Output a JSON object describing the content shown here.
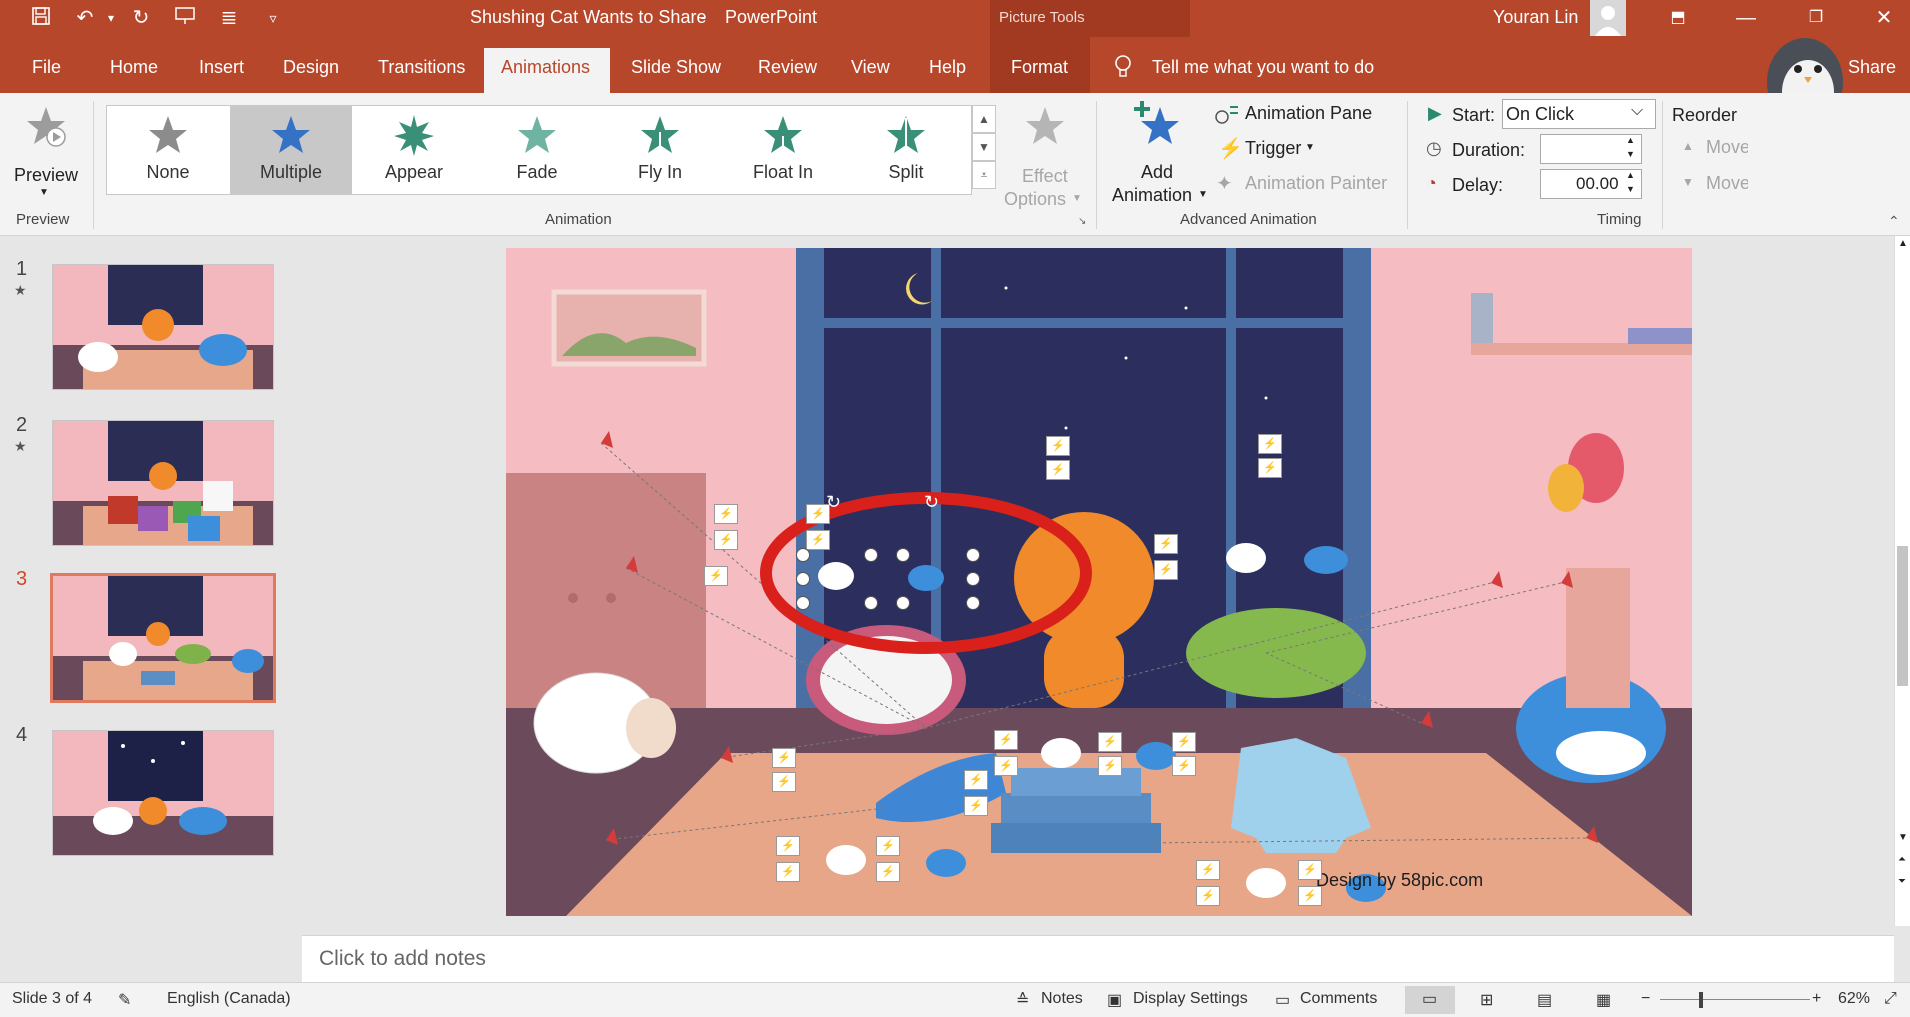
{
  "titlebar": {
    "doc_title": "Shushing Cat Wants to Share",
    "separator": "-",
    "app_name": "PowerPoint",
    "contextual_tools": "Picture Tools",
    "user_name": "Youran Lin",
    "quick_access": [
      "save-icon",
      "undo-icon",
      "undo-dropdown-icon",
      "redo-icon",
      "present-icon",
      "touch-mode-icon",
      "customize-icon"
    ]
  },
  "tabs": [
    {
      "label": "File"
    },
    {
      "label": "Home"
    },
    {
      "label": "Insert"
    },
    {
      "label": "Design"
    },
    {
      "label": "Transitions"
    },
    {
      "label": "Animations"
    },
    {
      "label": "Slide Show"
    },
    {
      "label": "Review"
    },
    {
      "label": "View"
    },
    {
      "label": "Help"
    },
    {
      "label": "Format"
    }
  ],
  "active_tab": "Animations",
  "tell_me": "Tell me what you want to do",
  "share_label": "Share",
  "ribbon": {
    "preview": {
      "label": "Preview",
      "group": "Preview"
    },
    "gallery": [
      {
        "label": "None"
      },
      {
        "label": "Multiple",
        "selected": true
      },
      {
        "label": "Appear"
      },
      {
        "label": "Fade"
      },
      {
        "label": "Fly In"
      },
      {
        "label": "Float In"
      },
      {
        "label": "Split"
      }
    ],
    "effect_options": {
      "line1": "Effect",
      "line2": "Options"
    },
    "animation_group": "Animation",
    "add_animation": {
      "line1": "Add",
      "line2": "Animation"
    },
    "animation_pane": "Animation Pane",
    "trigger": "Trigger",
    "animation_painter": "Animation Painter",
    "advanced_group": "Advanced Animation",
    "start_label": "Start:",
    "start_value": "On Click",
    "duration_label": "Duration:",
    "duration_value": "",
    "delay_label": "Delay:",
    "delay_value": "00.00",
    "timing_group": "Timing",
    "reorder": "Reorder",
    "move_earlier": "Move Earlier",
    "move_later": "Move Later"
  },
  "slides": [
    {
      "number": "1",
      "has_animation": true
    },
    {
      "number": "2",
      "has_animation": true
    },
    {
      "number": "3",
      "has_animation": false,
      "selected": true
    },
    {
      "number": "4",
      "has_animation": false
    }
  ],
  "slide_canvas": {
    "credit": "Design by 58pic.com"
  },
  "notes_placeholder": "Click to add notes",
  "status": {
    "slide_info": "Slide 3 of 4",
    "language": "English (Canada)",
    "notes": "Notes",
    "display_settings": "Display Settings",
    "comments": "Comments",
    "zoom": "62%"
  },
  "colors": {
    "accent": "#b7472a",
    "ribbon": "#f3f3f3",
    "selection_ring": "#d9201a"
  }
}
